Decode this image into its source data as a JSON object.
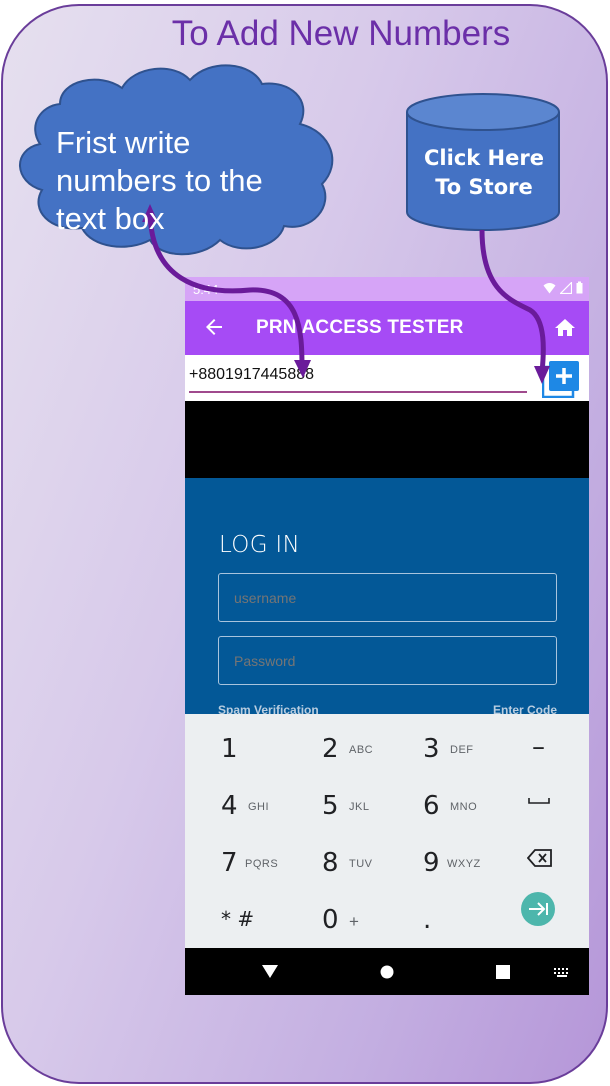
{
  "headline": "To Add New Numbers",
  "callouts": {
    "cloud_lines": [
      "Frist write",
      "numbers to the",
      "text box"
    ],
    "cylinder_lines": [
      "Click Here",
      "To Store"
    ]
  },
  "status_bar": {
    "time": "5:44"
  },
  "app_bar": {
    "title": "PRN ACCESS TESTER",
    "back_icon": "arrow-back-icon",
    "home_icon": "home-icon"
  },
  "number_input": {
    "value": "+8801917445888"
  },
  "add_button": {
    "icon": "add-box-icon"
  },
  "web_login": {
    "heading": "LOG IN",
    "username_placeholder": "username",
    "password_placeholder": "Password",
    "spam_label": "Spam Verification",
    "code_label": "Enter Code"
  },
  "keypad": {
    "keys": [
      {
        "digit": "1",
        "letters": ""
      },
      {
        "digit": "2",
        "letters": "ABC"
      },
      {
        "digit": "3",
        "letters": "DEF"
      },
      {
        "symbol": "–"
      },
      {
        "digit": "4",
        "letters": "GHI"
      },
      {
        "digit": "5",
        "letters": "JKL"
      },
      {
        "digit": "6",
        "letters": "MNO"
      },
      {
        "symbol": "space-icon"
      },
      {
        "digit": "7",
        "letters": "PQRS"
      },
      {
        "digit": "8",
        "letters": "TUV"
      },
      {
        "digit": "9",
        "letters": "WXYZ"
      },
      {
        "symbol": "backspace-icon"
      },
      {
        "digit": "* #",
        "letters": ""
      },
      {
        "digit": "0",
        "letters": "+"
      },
      {
        "digit": ".",
        "letters": ""
      },
      {
        "symbol": "next-icon"
      }
    ]
  },
  "colors": {
    "app_bar": "#a64bf5",
    "status_bar": "#d6a4f7",
    "web_panel": "#035897",
    "keypad": "#eceff1",
    "next_key": "#4db6ac",
    "callout_fill": "#4472c4",
    "arrow": "#6a1b9a"
  }
}
